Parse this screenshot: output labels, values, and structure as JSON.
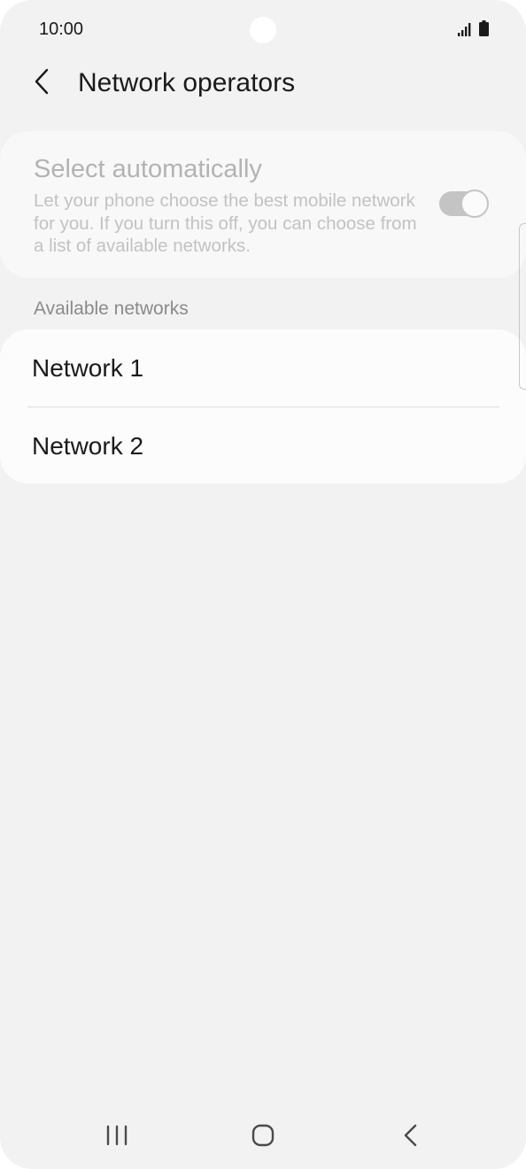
{
  "status_bar": {
    "time": "10:00"
  },
  "header": {
    "title": "Network operators",
    "back_icon": "chevron-left-icon"
  },
  "auto_select": {
    "title": "Select automatically",
    "description": "Let your phone choose the best mobile network for you. If you turn this off, you can choose from a list of available networks.",
    "enabled": true,
    "disabled_appearance": true
  },
  "available": {
    "header": "Available networks",
    "networks": [
      {
        "label": "Network 1"
      },
      {
        "label": "Network 2"
      }
    ]
  },
  "nav_bar": {
    "recents_icon": "recents-icon",
    "home_icon": "home-icon",
    "back_icon": "back-icon"
  },
  "colors": {
    "background": "#f2f2f2",
    "card": "#fcfcfc",
    "disabled_text": "#b3b3b3",
    "primary_text": "#1a1a1a"
  }
}
